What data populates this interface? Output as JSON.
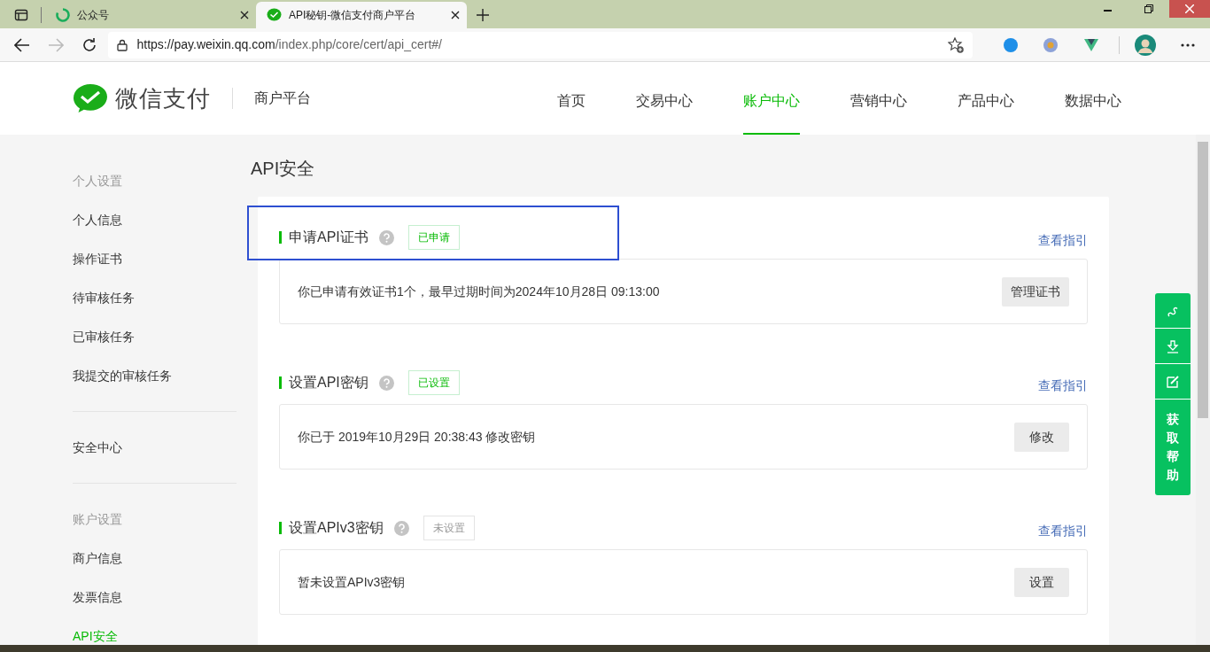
{
  "browser": {
    "tabs": [
      {
        "title": "公众号",
        "selected": false
      },
      {
        "title": "API秘钥-微信支付商户平台",
        "selected": true
      }
    ],
    "url_host": "https://pay.weixin.qq.com",
    "url_path": "/index.php/core/cert/api_cert#/"
  },
  "header": {
    "logo_text": "微信支付",
    "subtitle": "商户平台",
    "nav": [
      {
        "label": "首页",
        "selected": false
      },
      {
        "label": "交易中心",
        "selected": false
      },
      {
        "label": "账户中心",
        "selected": true
      },
      {
        "label": "营销中心",
        "selected": false
      },
      {
        "label": "产品中心",
        "selected": false
      },
      {
        "label": "数据中心",
        "selected": false
      }
    ]
  },
  "sidebar": {
    "groups": [
      {
        "heading": "个人设置",
        "items": [
          {
            "label": "个人信息",
            "selected": false
          },
          {
            "label": "操作证书",
            "selected": false
          },
          {
            "label": "待审核任务",
            "selected": false
          },
          {
            "label": "已审核任务",
            "selected": false
          },
          {
            "label": "我提交的审核任务",
            "selected": false
          }
        ]
      },
      {
        "items": [
          {
            "label": "安全中心",
            "selected": false
          }
        ]
      },
      {
        "heading": "账户设置",
        "items": [
          {
            "label": "商户信息",
            "selected": false
          },
          {
            "label": "发票信息",
            "selected": false
          },
          {
            "label": "API安全",
            "selected": true
          }
        ]
      }
    ]
  },
  "page_title": "API安全",
  "sections": [
    {
      "title": "申请API证书",
      "status": "已申请",
      "set": true,
      "guide_link": "查看指引",
      "description": "你已申请有效证书1个，最早过期时间为2024年10月28日 09:13:00",
      "button": "管理证书",
      "highlighted": true
    },
    {
      "title": "设置API密钥",
      "status": "已设置",
      "set": true,
      "guide_link": "查看指引",
      "description": "你已于 2019年10月29日 20:38:43 修改密钥",
      "button": "修改",
      "highlighted": false
    },
    {
      "title": "设置APIv3密钥",
      "status": "未设置",
      "set": false,
      "guide_link": "查看指引",
      "description": "暂未设置APIv3密钥",
      "button": "设置",
      "highlighted": false
    }
  ],
  "help_panel": {
    "label": "获取帮助"
  }
}
